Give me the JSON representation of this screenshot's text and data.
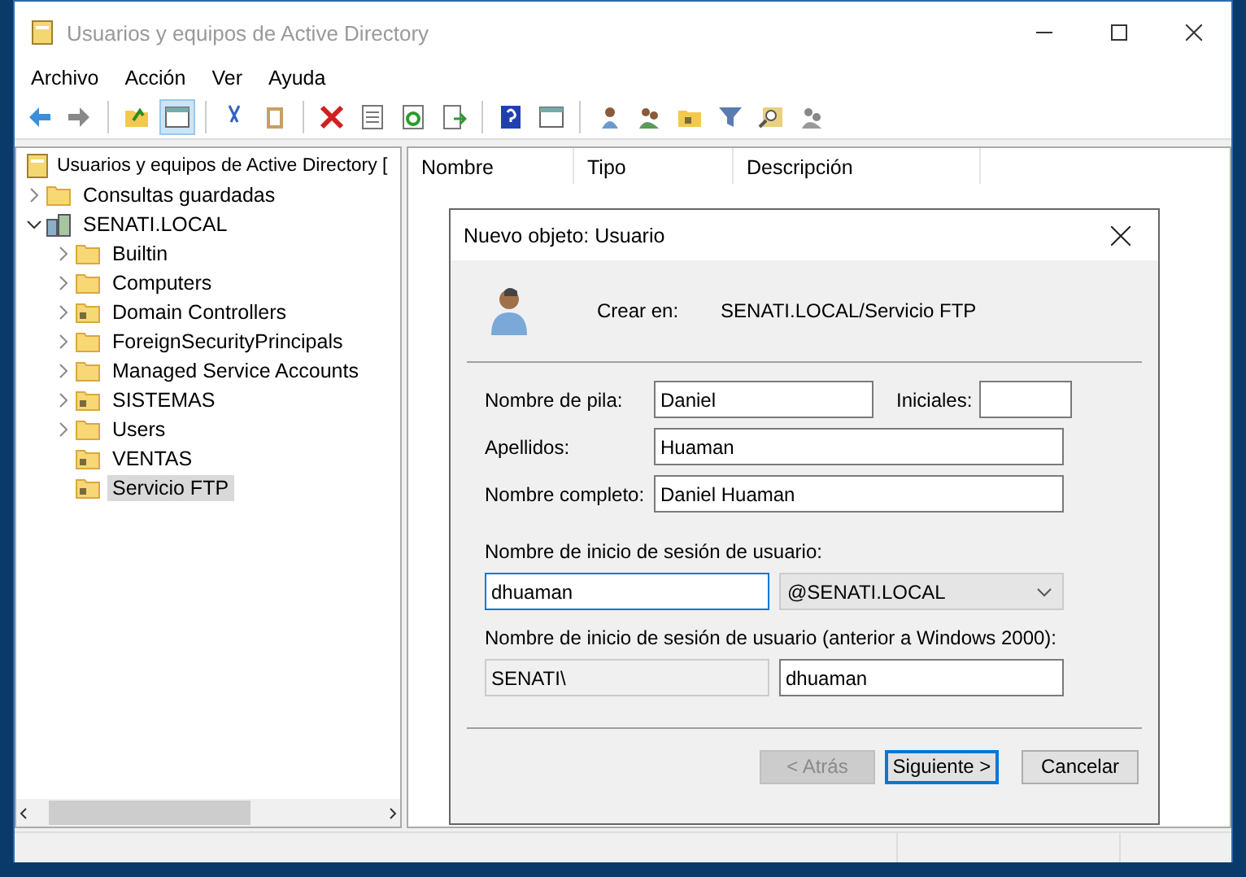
{
  "window": {
    "title": "Usuarios y equipos de Active Directory"
  },
  "menu": [
    "Archivo",
    "Acción",
    "Ver",
    "Ayuda"
  ],
  "toolbar": {
    "console_tree_pressed": true
  },
  "tree": [
    {
      "label": "Usuarios y equipos de Active Directory [",
      "kind": "root",
      "selected": false,
      "children": [
        {
          "label": "Consultas guardadas",
          "kind": "folder",
          "expanded": false,
          "selected": false
        },
        {
          "label": "SENATI.LOCAL",
          "kind": "domain",
          "expanded": true,
          "selected": false,
          "children": [
            {
              "label": "Builtin",
              "kind": "folder",
              "expanded": false,
              "selected": false
            },
            {
              "label": "Computers",
              "kind": "folder",
              "expanded": false,
              "selected": false
            },
            {
              "label": "Domain Controllers",
              "kind": "ou",
              "expanded": false,
              "selected": false
            },
            {
              "label": "ForeignSecurityPrincipals",
              "kind": "folder",
              "expanded": false,
              "selected": false
            },
            {
              "label": "Managed Service Accounts",
              "kind": "folder",
              "expanded": false,
              "selected": false
            },
            {
              "label": "SISTEMAS",
              "kind": "ou",
              "expanded": false,
              "selected": false
            },
            {
              "label": "Users",
              "kind": "folder",
              "expanded": false,
              "selected": false
            },
            {
              "label": "VENTAS",
              "kind": "ou",
              "selected": false
            },
            {
              "label": "Servicio FTP",
              "kind": "ou",
              "selected": true
            }
          ]
        }
      ]
    }
  ],
  "list": {
    "columns": [
      "Nombre",
      "Tipo",
      "Descripción"
    ]
  },
  "dialog": {
    "title": "Nuevo objeto: Usuario",
    "create_in_label": "Crear en:",
    "create_in_value": "SENATI.LOCAL/Servicio FTP",
    "first_name": {
      "label": "Nombre de pila:",
      "value": "Daniel"
    },
    "initials": {
      "label": "Iniciales:"
    },
    "last_name": {
      "label": "Apellidos:",
      "value": "Huaman"
    },
    "full_name": {
      "label": "Nombre completo:",
      "value": "Daniel Huaman"
    },
    "logon": {
      "label": "Nombre de inicio de sesión de usuario:",
      "value": "dhuaman",
      "focused": true,
      "domain": "@SENATI.LOCAL"
    },
    "legacy": {
      "label": "Nombre de inicio de sesión de usuario (anterior a Windows 2000):",
      "prefix": "SENATI\\",
      "value": "dhuaman"
    },
    "buttons": [
      {
        "label": "< Atrás",
        "disabled": true,
        "default": false
      },
      {
        "label": "Siguiente >",
        "disabled": false,
        "default": true
      },
      {
        "label": "Cancelar",
        "disabled": false,
        "default": false
      }
    ]
  }
}
